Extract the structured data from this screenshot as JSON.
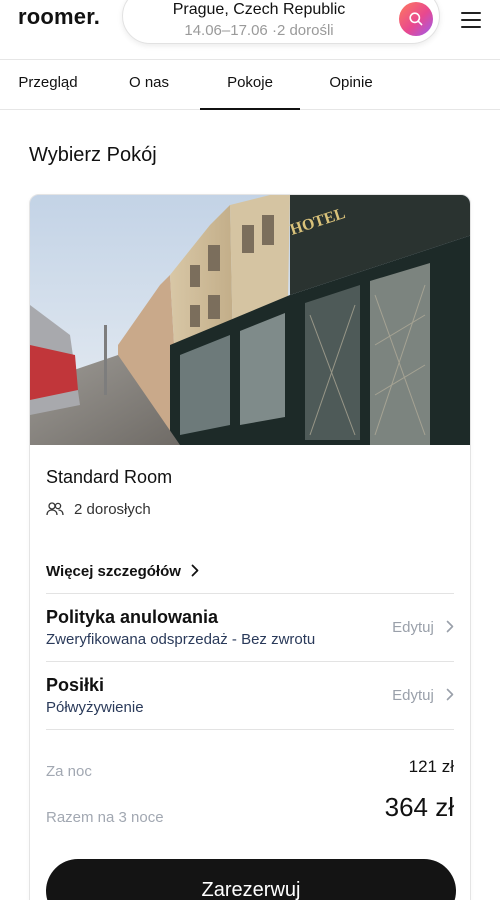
{
  "brand": {
    "logo": "roomer."
  },
  "search": {
    "city": "Prague, Czech Republic",
    "details": "14.06–17.06 ·2 dorośli",
    "button_icon": "search-icon"
  },
  "menu": {
    "icon": "hamburger-menu-icon"
  },
  "tabs": [
    {
      "label": "Przegląd",
      "active": false
    },
    {
      "label": "O nas",
      "active": false
    },
    {
      "label": "Pokoje",
      "active": true
    },
    {
      "label": "Opinie",
      "active": false
    }
  ],
  "section": {
    "title": "Wybierz Pokój"
  },
  "room": {
    "name": "Standard Room",
    "guests": "2 dorosłych",
    "guests_icon": "users-icon",
    "more_details": "Więcej szczegółów",
    "cancellation": {
      "title": "Polityka anulowania",
      "value": "Zweryfikowana odsprzedaż - Bez zwrotu",
      "edit": "Edytuj"
    },
    "meals": {
      "title": "Posiłki",
      "value": "Półwyżywienie",
      "edit": "Edytuj"
    },
    "price": {
      "per_night_label": "Za noc",
      "per_night": "121 zł",
      "total_label": "Razem na 3 noce",
      "total": "364 zł"
    },
    "book_label": "Zarezerwuj"
  },
  "photo_sign": "HOTEL",
  "colors": {
    "accent_gradient": [
      "#ff7a5c",
      "#e8488f",
      "#9b5cf0"
    ],
    "primary_button": "#141414",
    "muted_text": "#9aa0aa"
  }
}
